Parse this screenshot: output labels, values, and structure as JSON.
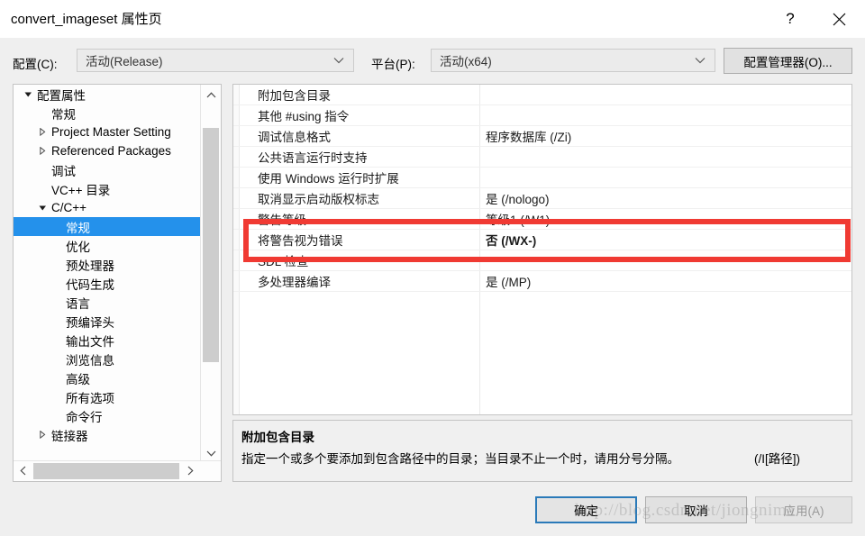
{
  "window": {
    "title": "convert_imageset 属性页",
    "help_icon": "?",
    "close_icon": "close-icon"
  },
  "config_bar": {
    "configuration_label": "配置(C):",
    "configuration_value": "活动(Release)",
    "platform_label": "平台(P):",
    "platform_value": "活动(x64)",
    "config_manager_label": "配置管理器(O)..."
  },
  "tree": {
    "items": [
      {
        "label": "配置属性",
        "depth": 0,
        "twisty": "expanded",
        "selected": false
      },
      {
        "label": "常规",
        "depth": 1,
        "twisty": "none",
        "selected": false
      },
      {
        "label": "Project Master Setting",
        "depth": 1,
        "twisty": "collapsed",
        "selected": false
      },
      {
        "label": "Referenced Packages",
        "depth": 1,
        "twisty": "collapsed",
        "selected": false
      },
      {
        "label": "调试",
        "depth": 1,
        "twisty": "none",
        "selected": false
      },
      {
        "label": "VC++ 目录",
        "depth": 1,
        "twisty": "none",
        "selected": false
      },
      {
        "label": "C/C++",
        "depth": 1,
        "twisty": "expanded",
        "selected": false
      },
      {
        "label": "常规",
        "depth": 2,
        "twisty": "none",
        "selected": true
      },
      {
        "label": "优化",
        "depth": 2,
        "twisty": "none",
        "selected": false
      },
      {
        "label": "预处理器",
        "depth": 2,
        "twisty": "none",
        "selected": false
      },
      {
        "label": "代码生成",
        "depth": 2,
        "twisty": "none",
        "selected": false
      },
      {
        "label": "语言",
        "depth": 2,
        "twisty": "none",
        "selected": false
      },
      {
        "label": "预编译头",
        "depth": 2,
        "twisty": "none",
        "selected": false
      },
      {
        "label": "输出文件",
        "depth": 2,
        "twisty": "none",
        "selected": false
      },
      {
        "label": "浏览信息",
        "depth": 2,
        "twisty": "none",
        "selected": false
      },
      {
        "label": "高级",
        "depth": 2,
        "twisty": "none",
        "selected": false
      },
      {
        "label": "所有选项",
        "depth": 2,
        "twisty": "none",
        "selected": false
      },
      {
        "label": "命令行",
        "depth": 2,
        "twisty": "none",
        "selected": false
      },
      {
        "label": "链接器",
        "depth": 1,
        "twisty": "collapsed",
        "selected": false
      }
    ]
  },
  "properties": {
    "rows": [
      {
        "name": "附加包含目录",
        "value": "",
        "bold": false
      },
      {
        "name": "其他 #using 指令",
        "value": "",
        "bold": false
      },
      {
        "name": "调试信息格式",
        "value": "程序数据库 (/Zi)",
        "bold": false
      },
      {
        "name": "公共语言运行时支持",
        "value": "",
        "bold": false
      },
      {
        "name": "使用 Windows 运行时扩展",
        "value": "",
        "bold": false
      },
      {
        "name": "取消显示启动版权标志",
        "value": "是 (/nologo)",
        "bold": false
      },
      {
        "name": "警告等级",
        "value": "等级1 (/W1)",
        "bold": false
      },
      {
        "name": "将警告视为错误",
        "value": "否 (/WX-)",
        "bold": true
      },
      {
        "name": "SDL 检查",
        "value": "",
        "bold": false
      },
      {
        "name": "多处理器编译",
        "value": "是 (/MP)",
        "bold": false
      }
    ]
  },
  "description": {
    "title": "附加包含目录",
    "body": "指定一个或多个要添加到包含路径中的目录；当目录不止一个时，请用分号分隔。",
    "hint": "(/I[路径])"
  },
  "footer": {
    "ok_label": "确定",
    "cancel_label": "取消",
    "apply_label": "应用(A)"
  },
  "watermark": {
    "text": "http://blog.csdn.net/jiongnima"
  },
  "colors": {
    "selection": "#2491eb",
    "highlight_box": "#f03a33",
    "default_button_border": "#2a7ab9",
    "dialog_background": "#efefef"
  }
}
